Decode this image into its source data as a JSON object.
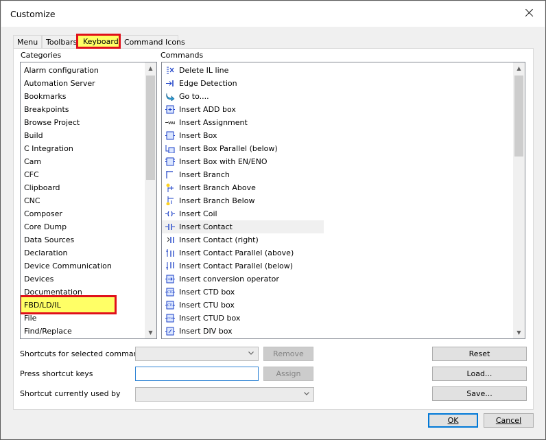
{
  "window": {
    "title": "Customize"
  },
  "tabs": [
    {
      "label": "Menu"
    },
    {
      "label": "Toolbars"
    },
    {
      "label": "Keyboard"
    },
    {
      "label": "Command Icons"
    }
  ],
  "categories": {
    "label": "Categories",
    "items": [
      "Alarm configuration",
      "Automation Server",
      "Bookmarks",
      "Breakpoints",
      "Browse Project",
      "Build",
      "C Integration",
      "Cam",
      "CFC",
      "Clipboard",
      "CNC",
      "Composer",
      "Core Dump",
      "Data Sources",
      "Declaration",
      "Device Communication",
      "Devices",
      "Documentation",
      "FBD/LD/IL",
      "File",
      "Find/Replace"
    ],
    "selected": "FBD/LD/IL"
  },
  "commands": {
    "label": "Commands",
    "items": [
      {
        "label": "Delete IL line",
        "icon": "delete-il-line-icon"
      },
      {
        "label": "Edge Detection",
        "icon": "edge-detection-icon"
      },
      {
        "label": "Go to....",
        "icon": "goto-arrow-icon"
      },
      {
        "label": "Insert ADD box",
        "icon": "add-box-icon"
      },
      {
        "label": "Insert Assignment",
        "icon": "assignment-var-icon"
      },
      {
        "label": "Insert Box",
        "icon": "box-icon"
      },
      {
        "label": "Insert Box Parallel (below)",
        "icon": "box-parallel-icon"
      },
      {
        "label": "Insert Box with EN/ENO",
        "icon": "box-en-eno-icon"
      },
      {
        "label": "Insert Branch",
        "icon": "branch-icon"
      },
      {
        "label": "Insert Branch Above",
        "icon": "branch-above-icon"
      },
      {
        "label": "Insert Branch Below",
        "icon": "branch-below-icon"
      },
      {
        "label": "Insert Coil",
        "icon": "coil-icon"
      },
      {
        "label": "Insert Contact",
        "icon": "contact-icon"
      },
      {
        "label": "Insert Contact (right)",
        "icon": "contact-right-icon"
      },
      {
        "label": "Insert Contact Parallel (above)",
        "icon": "contact-parallel-above-icon"
      },
      {
        "label": "Insert Contact Parallel (below)",
        "icon": "contact-parallel-below-icon"
      },
      {
        "label": "Insert conversion operator",
        "icon": "conversion-icon"
      },
      {
        "label": "Insert CTD box",
        "icon": "ctd-box-icon"
      },
      {
        "label": "Insert CTU box",
        "icon": "ctu-box-icon"
      },
      {
        "label": "Insert CTUD box",
        "icon": "ctud-box-icon"
      },
      {
        "label": "Insert DIV box",
        "icon": "div-box-icon"
      }
    ],
    "hovered": "Insert Contact"
  },
  "shortcuts": {
    "selected_label": "Shortcuts for selected command",
    "press_label": "Press shortcut keys",
    "used_by_label": "Shortcut currently used by",
    "remove": "Remove",
    "assign": "Assign"
  },
  "side_buttons": {
    "reset": "Reset",
    "load": "Load...",
    "save": "Save..."
  },
  "footer": {
    "ok": "OK",
    "cancel": "Cancel"
  },
  "colors": {
    "highlight": "#ffff66",
    "annotation_border": "#e0101a",
    "focus": "#0078d7"
  }
}
